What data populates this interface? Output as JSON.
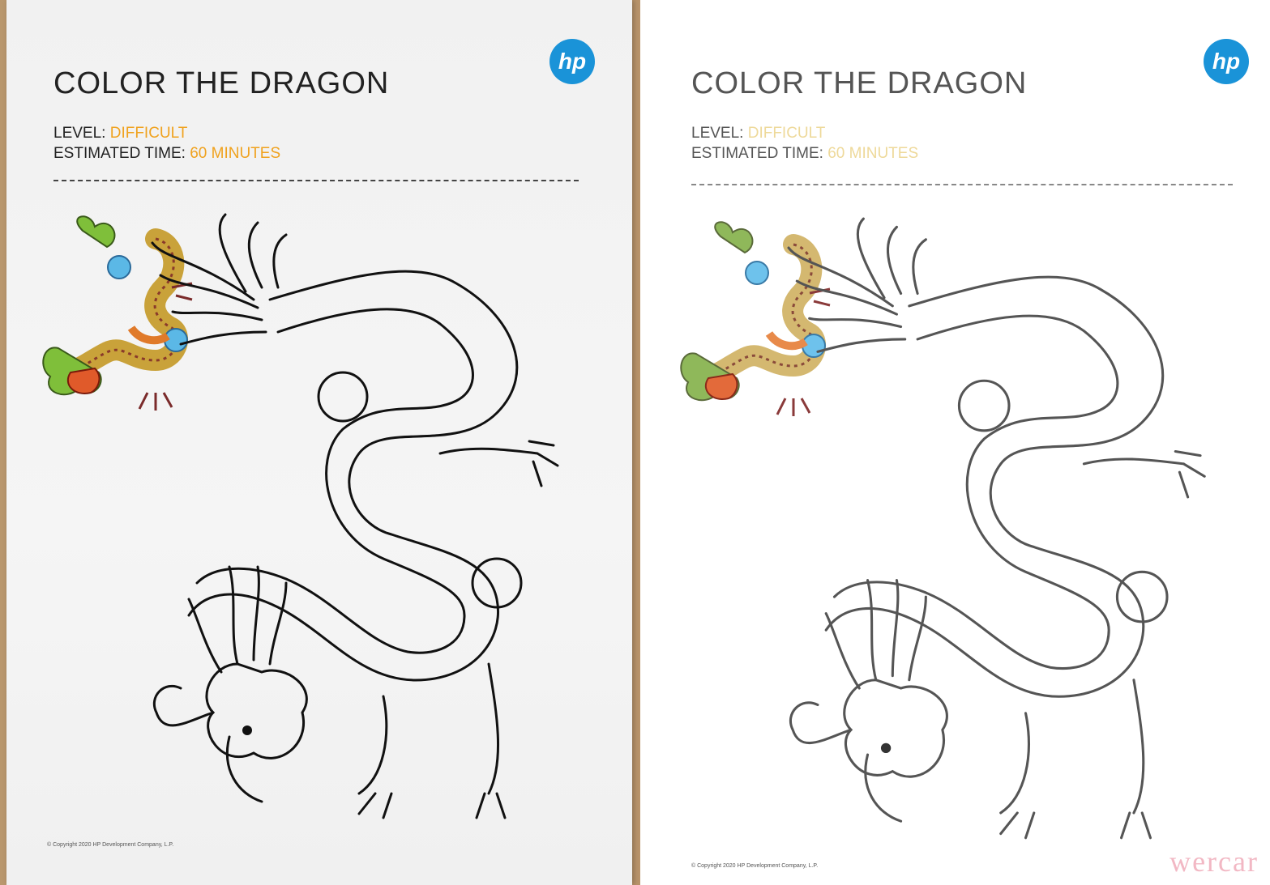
{
  "sheets": [
    {
      "logo_text": "hp",
      "title": "COLOR THE DRAGON",
      "level_label": "LEVEL:",
      "level_value": "DIFFICULT",
      "time_label": "ESTIMATED TIME:",
      "time_value": "60 MINUTES",
      "copyright": "© Copyright 2020 HP Development Company, L.P."
    },
    {
      "logo_text": "hp",
      "title": "COLOR THE DRAGON",
      "level_label": "LEVEL:",
      "level_value": "DIFFICULT",
      "time_label": "ESTIMATED TIME:",
      "time_value": "60 MINUTES",
      "copyright": "© Copyright 2020 HP Development Company, L.P."
    }
  ],
  "watermark": "wercar",
  "colors": {
    "hp_blue": "#1a93d8",
    "accent_orange": "#f0a21e",
    "accent_faded": "#eed99a",
    "wood": "#c8a67c"
  },
  "illustrations": [
    "colored-dragon-reference",
    "line-art-dragon-outline"
  ]
}
